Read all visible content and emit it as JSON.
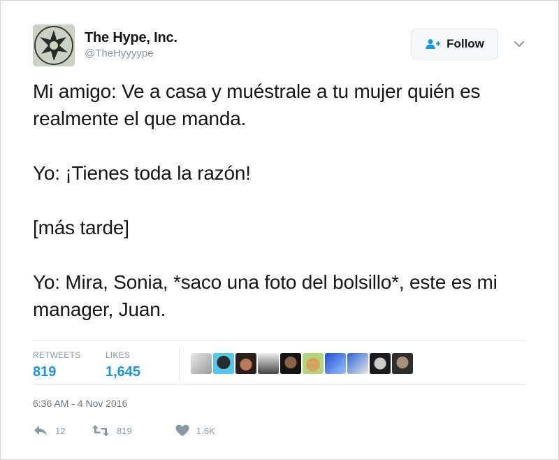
{
  "account": {
    "display_name": "The Hype, Inc.",
    "handle": "@TheHyyyype"
  },
  "follow_label": "Follow",
  "body": {
    "paragraphs": [
      "Mi amigo: Ve a casa y muéstrale a tu mujer quién es realmente el que manda.",
      "Yo: ¡Tienes toda la razón!",
      "[más tarde]",
      "Yo: Mira, Sonia, *saco una foto del bolsillo*, este es mi manager, Juan."
    ]
  },
  "stats": {
    "retweets_label": "RETWEETS",
    "retweets": "819",
    "likes_label": "LIKES",
    "likes": "1,645"
  },
  "timestamp": "6:36 AM - 4 Nov 2016",
  "actions": {
    "replies": "12",
    "retweets": "819",
    "likes": "1.6K"
  },
  "colors": {
    "link_blue": "#1b95e0",
    "muted_gray": "#8899a6",
    "text_dark": "#14171a"
  },
  "icons": [
    "follow-person-plus-icon",
    "chevron-down-icon",
    "reply-icon",
    "retweet-icon",
    "heart-icon"
  ]
}
